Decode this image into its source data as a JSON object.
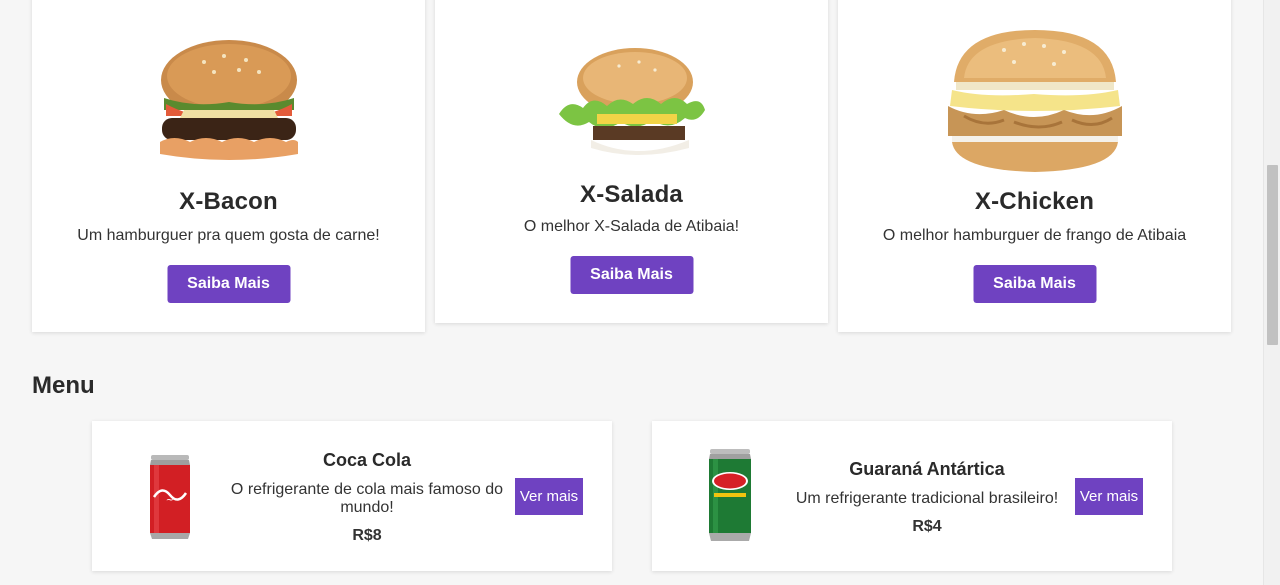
{
  "products": [
    {
      "title": "X-Bacon",
      "description": "Um hamburguer pra quem gosta de carne!",
      "button_label": "Saiba Mais"
    },
    {
      "title": "X-Salada",
      "description": "O melhor X-Salada de Atibaia!",
      "button_label": "Saiba Mais"
    },
    {
      "title": "X-Chicken",
      "description": "O melhor hamburguer de frango de Atibaia",
      "button_label": "Saiba Mais"
    }
  ],
  "menu": {
    "heading": "Menu",
    "items": [
      {
        "name": "Coca Cola",
        "description": "O refrigerante de cola mais famoso do mundo!",
        "price": "R$8",
        "button_label": "Ver mais",
        "can_color": "#d21f24"
      },
      {
        "name": "Guaraná Antártica",
        "description": "Um refrigerante tradicional brasileiro!",
        "price": "R$4",
        "button_label": "Ver mais",
        "can_color": "#1e7a34"
      }
    ]
  },
  "theme": {
    "accent": "#6f42c1",
    "background": "#f6f6f6",
    "card": "#ffffff"
  }
}
